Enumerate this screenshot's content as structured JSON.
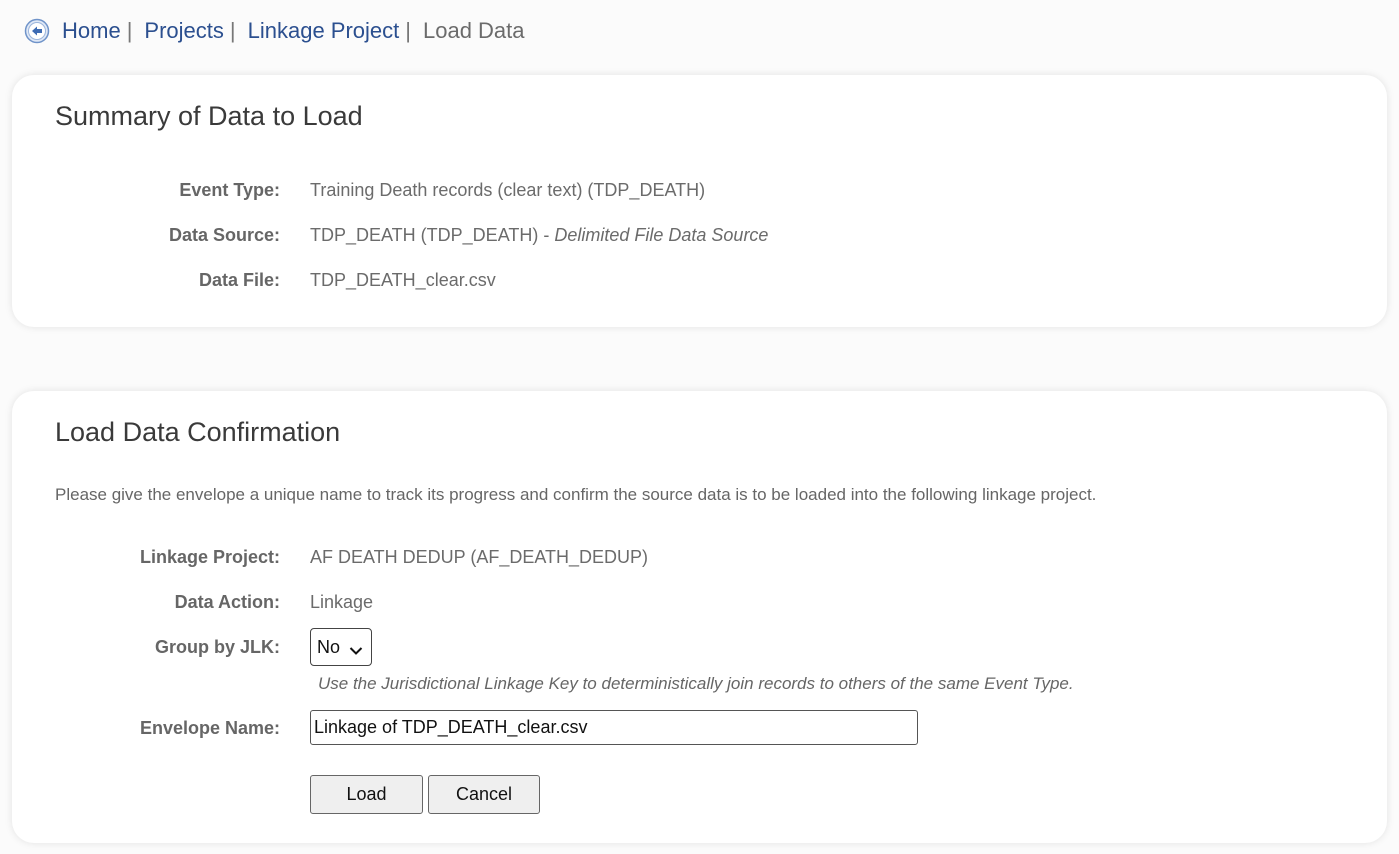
{
  "breadcrumb": {
    "items": [
      {
        "label": "Home"
      },
      {
        "label": "Projects"
      },
      {
        "label": "Linkage Project"
      }
    ],
    "separator": "|",
    "current": "Load Data"
  },
  "summary": {
    "title": "Summary of Data to Load",
    "event_type_label": "Event Type:",
    "event_type_value": "Training Death records (clear text) (TDP_DEATH)",
    "data_source_label": "Data Source:",
    "data_source_value": "TDP_DEATH (TDP_DEATH) - ",
    "data_source_kind": "Delimited File Data Source",
    "data_file_label": "Data File:",
    "data_file_value": "TDP_DEATH_clear.csv"
  },
  "confirmation": {
    "title": "Load Data Confirmation",
    "intro": "Please give the envelope a unique name to track its progress and confirm the source data is to be loaded into the following linkage project.",
    "linkage_project_label": "Linkage Project:",
    "linkage_project_value": "AF DEATH DEDUP (AF_DEATH_DEDUP)",
    "data_action_label": "Data Action:",
    "data_action_value": "Linkage",
    "group_by_label": "Group by JLK:",
    "group_by_selected": "No",
    "group_by_hint": "Use the Jurisdictional Linkage Key to deterministically join records to others of the same Event Type.",
    "envelope_name_label": "Envelope Name:",
    "envelope_name_value": "Linkage of TDP_DEATH_clear.csv",
    "load_button": "Load",
    "cancel_button": "Cancel"
  },
  "colors": {
    "link": "#2b4f8f",
    "back_icon": "#3d6bb3"
  }
}
